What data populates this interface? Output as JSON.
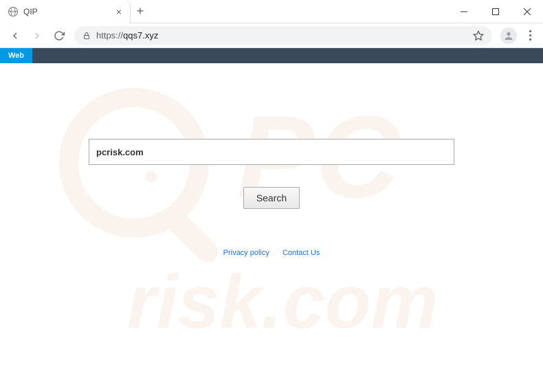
{
  "window": {
    "tab_title": "QIP"
  },
  "addressbar": {
    "protocol": "https://",
    "host": "qqs7.xyz"
  },
  "page_nav": {
    "web_label": "Web"
  },
  "search": {
    "input_value": "pcrisk.com",
    "button_label": "Search"
  },
  "footer": {
    "privacy": "Privacy policy",
    "contact": "Contact Us"
  },
  "watermark": {
    "text_top": "PC",
    "text_bottom": "risk.com"
  }
}
